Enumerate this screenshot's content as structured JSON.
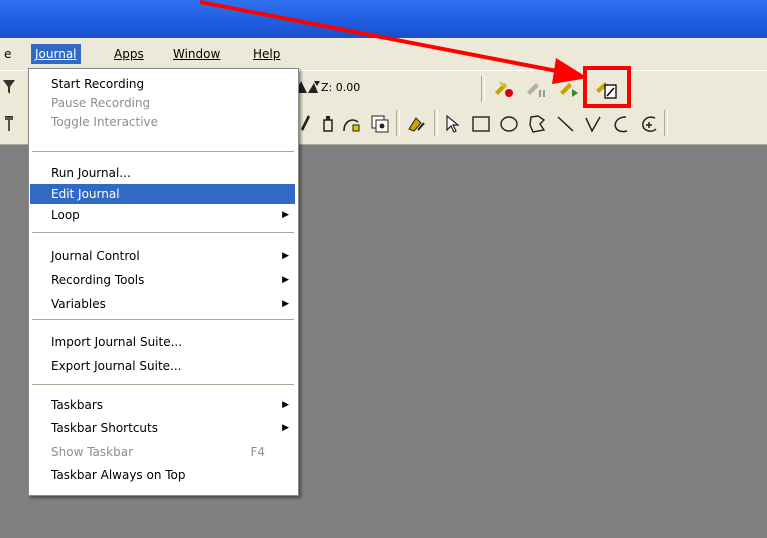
{
  "menubar": {
    "partial": "e",
    "journal": "Journal",
    "apps": "Apps",
    "window": "Window",
    "help": "Help"
  },
  "toolbar": {
    "z_readout": "Z: 0.00"
  },
  "journal_menu": {
    "items": [
      {
        "label": "Start Recording",
        "enabled": true
      },
      {
        "label": "Pause Recording",
        "enabled": false
      },
      {
        "label": "Toggle Interactive",
        "enabled": false
      },
      {
        "label": "Run Journal...",
        "enabled": true
      },
      {
        "label": "Edit Journal",
        "enabled": true,
        "highlighted": true
      },
      {
        "label": "Loop",
        "enabled": true,
        "submenu": true
      },
      {
        "label": "Journal Control",
        "enabled": true,
        "submenu": true
      },
      {
        "label": "Recording Tools",
        "enabled": true,
        "submenu": true
      },
      {
        "label": "Variables",
        "enabled": true,
        "submenu": true
      },
      {
        "label": "Import Journal Suite...",
        "enabled": true
      },
      {
        "label": "Export Journal Suite...",
        "enabled": true
      },
      {
        "label": "Taskbars",
        "enabled": true,
        "submenu": true
      },
      {
        "label": "Taskbar Shortcuts",
        "enabled": true,
        "submenu": true
      },
      {
        "label": "Show Taskbar",
        "enabled": false,
        "shortcut": "F4"
      },
      {
        "label": "Taskbar Always on Top",
        "enabled": true
      }
    ]
  },
  "colors": {
    "title_bar": "#2f72f0",
    "menu_highlight": "#316ac5",
    "annotation": "#ff0000",
    "workspace": "#808080"
  },
  "icons": [
    "funnel-icon",
    "snap-icon",
    "record-start-icon",
    "record-pause-icon",
    "journal-run-icon",
    "journal-edit-icon",
    "select-arrow-icon",
    "rectangle-tool-icon",
    "circle-tool-icon",
    "polygon-tool-icon",
    "line-tool-icon",
    "v-tool-icon",
    "arc-tool-icon",
    "add-point-icon"
  ]
}
